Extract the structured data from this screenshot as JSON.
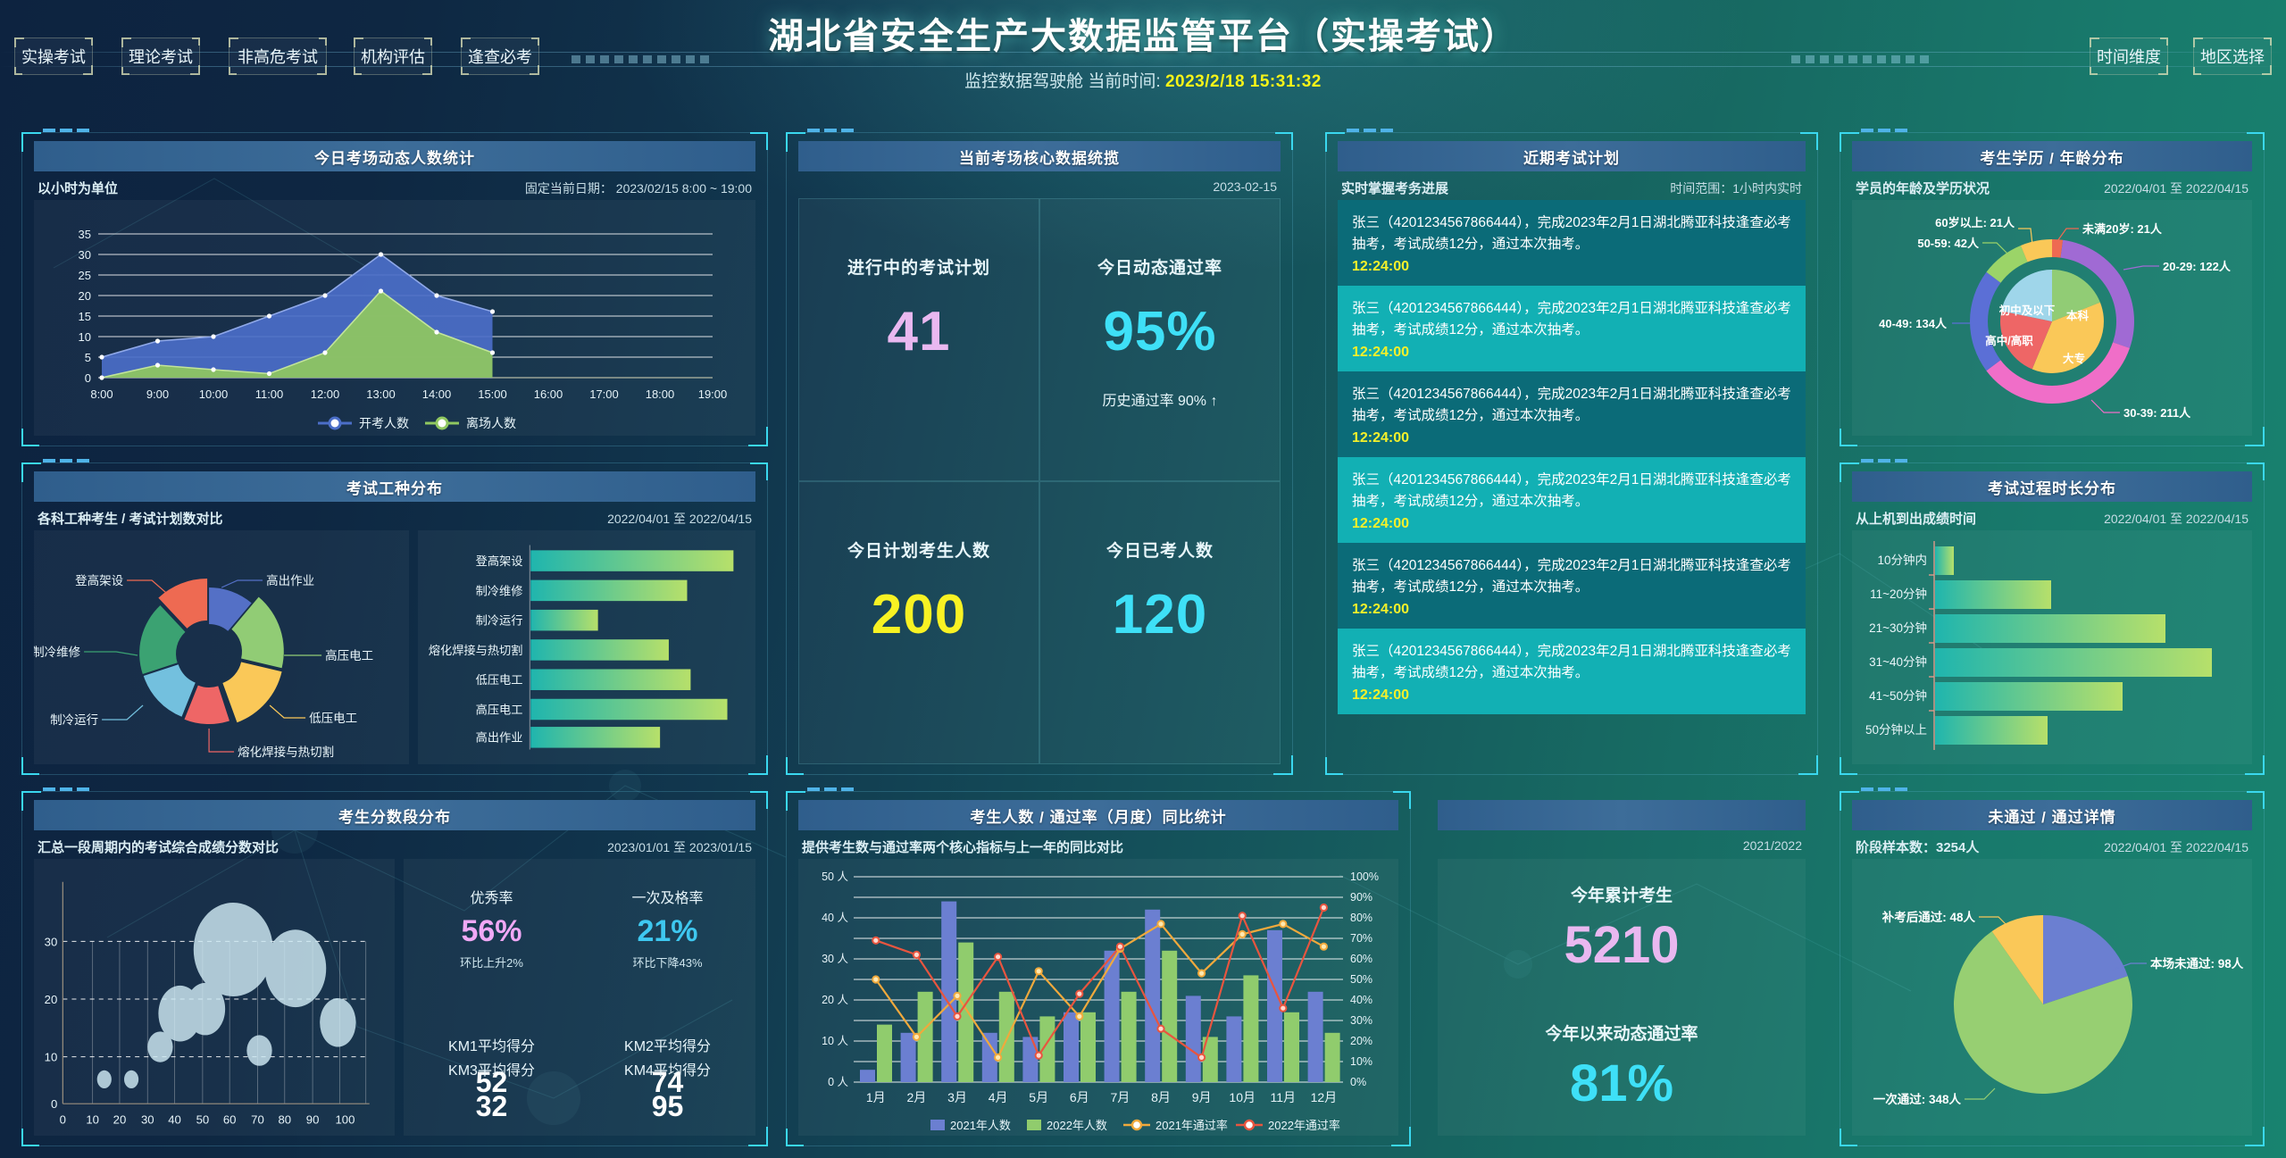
{
  "header": {
    "title": "湖北省安全生产大数据监管平台（实操考试）",
    "subtitle_prefix": "监控数据驾驶舱 当前时间:",
    "clock": "2023/2/18 15:31:32",
    "left_buttons": [
      "实操考试",
      "理论考试",
      "非高危考试",
      "机构评估",
      "逢查必考"
    ],
    "right_buttons": [
      "时间维度",
      "地区选择"
    ],
    "clock_color": "#f7f318"
  },
  "panels": {
    "attendance": {
      "title": "今日考场动态人数统计",
      "subtitle": "以小时为单位",
      "date": "固定当前日期： 2023/02/15 8:00 ~ 19:00"
    },
    "worktype": {
      "title": "考试工种分布",
      "subtitle": "各科工种考生 / 考试计划数对比",
      "date": "2022/04/01 至 2022/04/15"
    },
    "core": {
      "title": "当前考场核心数据统揽",
      "date": "2023-02-15",
      "cells": [
        {
          "label": "进行中的考试计划",
          "value": "41",
          "color": "#e9b8f0",
          "note": ""
        },
        {
          "label": "今日动态通过率",
          "value": "95%",
          "color": "#3ee0f7",
          "note": "历史通过率 90% ↑"
        },
        {
          "label": "今日计划考生人数",
          "value": "200",
          "color": "#f8f223",
          "note": ""
        },
        {
          "label": "今日已考人数",
          "value": "120",
          "color": "#3ee0f7",
          "note": ""
        }
      ]
    },
    "plans": {
      "title": "近期考试计划",
      "subtitle": "实时掌握考务进展",
      "date": "时间范围：1小时内实时",
      "items": [
        {
          "text": "张三（4201234567866444），完成2023年2月1日湖北腾亚科技逢查必考抽考，考试成绩12分，通过本次抽考。",
          "time": "12:24:00",
          "bg": "#0b6b78"
        },
        {
          "text": "张三（4201234567866444），完成2023年2月1日湖北腾亚科技逢查必考抽考，考试成绩12分，通过本次抽考。",
          "time": "12:24:00",
          "bg": "#12b0b4"
        },
        {
          "text": "张三（4201234567866444），完成2023年2月1日湖北腾亚科技逢查必考抽考，考试成绩12分，通过本次抽考。",
          "time": "12:24:00",
          "bg": "#0b6b78"
        },
        {
          "text": "张三（4201234567866444），完成2023年2月1日湖北腾亚科技逢查必考抽考，考试成绩12分，通过本次抽考。",
          "time": "12:24:00",
          "bg": "#12b0b4"
        },
        {
          "text": "张三（4201234567866444），完成2023年2月1日湖北腾亚科技逢查必考抽考，考试成绩12分，通过本次抽考。",
          "time": "12:24:00",
          "bg": "#0b6b78"
        },
        {
          "text": "张三（4201234567866444），完成2023年2月1日湖北腾亚科技逢查必考抽考，考试成绩12分，通过本次抽考。",
          "time": "12:24:00",
          "bg": "#12b0b4"
        }
      ]
    },
    "demographics": {
      "title": "考生学历 / 年龄分布",
      "subtitle": "学员的年龄及学历状况",
      "date": "2022/04/01 至 2022/04/15"
    },
    "duration": {
      "title": "考试过程时长分布",
      "subtitle": "从上机到出成绩时间",
      "date": "2022/04/01 至 2022/04/15"
    },
    "scores": {
      "title": "考生分数段分布",
      "subtitle": "汇总一段周期内的考试综合成绩分数对比",
      "date": "2023/01/01 至 2023/01/15",
      "stats": [
        {
          "label": "优秀率",
          "value": "56%",
          "color": "#f0a8f5",
          "note": "环比上升2%"
        },
        {
          "label": "一次及格率",
          "value": "21%",
          "color": "#3ec8f0",
          "note": "环比下降43%"
        },
        {
          "label": "KM1平均得分",
          "value": "52"
        },
        {
          "label": "KM2平均得分",
          "value": "74"
        },
        {
          "label": "KM3平均得分",
          "value": "32"
        },
        {
          "label": "KM4平均得分",
          "value": "95"
        }
      ]
    },
    "monthly": {
      "title": "考生人数 / 通过率（月度）同比统计",
      "subtitle": "提供考生数与通过率两个核心指标与上一年的同比对比",
      "date": "2021/2022",
      "year_stats": [
        {
          "label": "今年累计考生",
          "value": "5210",
          "color": "#e9b8f0"
        },
        {
          "label": "今年以来动态通过率",
          "value": "81%",
          "color": "#3ee0f7"
        }
      ]
    },
    "passdetail": {
      "title": "未通过 / 通过详情",
      "subtitle": "阶段样本数：3254人",
      "date": "2022/04/01 至 2022/04/15"
    }
  },
  "chart_data": [
    {
      "type": "area",
      "id": "attendance",
      "title": "今日考场动态人数统计",
      "xlabel": "",
      "ylabel": "",
      "categories": [
        "8:00",
        "9:00",
        "10:00",
        "11:00",
        "12:00",
        "13:00",
        "14:00",
        "15:00",
        "16:00",
        "17:00",
        "18:00",
        "19:00"
      ],
      "ylim": [
        0,
        37
      ],
      "yticks": [
        0,
        5,
        10,
        15,
        20,
        25,
        30,
        35
      ],
      "grid": true,
      "legend_position": "bottom",
      "series": [
        {
          "name": "开考人数",
          "color": "#4b6ec8",
          "values": [
            5,
            9,
            10,
            15,
            21,
            31,
            21,
            16,
            null,
            null,
            null,
            null
          ]
        },
        {
          "name": "离场人数",
          "color": "#90c860",
          "values": [
            0,
            3,
            2,
            1,
            6,
            21,
            11,
            6,
            null,
            null,
            null,
            null
          ]
        }
      ]
    },
    {
      "type": "pie",
      "id": "worktype-donut",
      "title": "各科工种考生",
      "labels": [
        "高出作业",
        "高压电工",
        "低压电工",
        "熔化焊接与热切割",
        "制冷运行",
        "制冷维修",
        "登高架设"
      ],
      "values": [
        13,
        16,
        14,
        11,
        8,
        17,
        21
      ],
      "colors": [
        "#5470c6",
        "#91cc75",
        "#fac858",
        "#ee6666",
        "#73c0de",
        "#3ba272",
        "#ee6a52"
      ]
    },
    {
      "type": "bar",
      "id": "worktype-bars",
      "title": "考试计划数",
      "orientation": "horizontal",
      "categories": [
        "登高架设",
        "制冷维修",
        "制冷运行",
        "熔化焊接与热切割",
        "低压电工",
        "高压电工",
        "高出作业"
      ],
      "values": [
        100,
        77,
        33,
        68,
        79,
        97,
        64
      ],
      "xlim": [
        0,
        105
      ]
    },
    {
      "type": "pie",
      "id": "education-inner",
      "title": "考生学历分布",
      "labels": [
        "本科",
        "大专",
        "高中/高职",
        "初中及以下"
      ],
      "values": [
        22,
        37,
        26,
        15
      ],
      "colors": [
        "#91cc75",
        "#fac858",
        "#ee6666",
        "#9fd6ea"
      ]
    },
    {
      "type": "pie",
      "id": "age-outer",
      "title": "考生年龄分布",
      "labels": [
        "未满20岁: 21人",
        "20-29: 122人",
        "30-39: 211人",
        "40-49: 134人",
        "50-59: 42人",
        "60岁以上: 21人"
      ],
      "short_labels": [
        "未满20岁",
        "20-29",
        "30-39",
        "40-49",
        "50-59",
        "60岁以上"
      ],
      "values": [
        21,
        122,
        211,
        134,
        42,
        21
      ],
      "colors": [
        "#ee6a52",
        "#a06ad4",
        "#f06ec8",
        "#5b6fd6",
        "#9bd468",
        "#fac858"
      ]
    },
    {
      "type": "bar",
      "id": "duration",
      "title": "考试过程时长分布",
      "orientation": "horizontal",
      "categories": [
        "10分钟内",
        "11~20分钟",
        "21~30分钟",
        "31~40分钟",
        "41~50分钟",
        "50分钟以上"
      ],
      "values": [
        6,
        41,
        81,
        96,
        66,
        39
      ],
      "xlim": [
        0,
        100
      ]
    },
    {
      "type": "scatter",
      "id": "scores-bubble",
      "title": "考生分数段分布",
      "xlabel": "",
      "ylabel": "",
      "xlim": [
        0,
        100
      ],
      "ylim": [
        0,
        32
      ],
      "xticks": [
        0,
        10,
        20,
        30,
        40,
        50,
        60,
        70,
        80,
        90,
        100
      ],
      "yticks": [
        0,
        10,
        20,
        30
      ],
      "grid": true,
      "points": [
        {
          "x": 15,
          "y": 4,
          "r": 7
        },
        {
          "x": 25,
          "y": 4,
          "r": 7
        },
        {
          "x": 35,
          "y": 12,
          "r": 13
        },
        {
          "x": 75,
          "y": 11,
          "r": 13
        },
        {
          "x": 42,
          "y": 17,
          "r": 22
        },
        {
          "x": 50,
          "y": 18,
          "r": 21
        },
        {
          "x": 93,
          "y": 15,
          "r": 19
        },
        {
          "x": 63,
          "y": 27,
          "r": 42
        },
        {
          "x": 82,
          "y": 23,
          "r": 33
        }
      ]
    },
    {
      "type": "bar",
      "id": "monthly",
      "title": "考生人数 / 通过率（月度）同比统计",
      "categories": [
        "1月",
        "2月",
        "3月",
        "4月",
        "5月",
        "6月",
        "7月",
        "8月",
        "9月",
        "10月",
        "11月",
        "12月"
      ],
      "ylabel_left": "人",
      "ylabel_right": "%",
      "ylim_left": [
        0,
        50
      ],
      "ylim_right": [
        0,
        100
      ],
      "yticks_left": [
        0,
        10,
        20,
        30,
        40,
        50
      ],
      "yticks_right": [
        0,
        10,
        20,
        30,
        40,
        50,
        60,
        70,
        80,
        90,
        100
      ],
      "series": [
        {
          "name": "2021年人数",
          "type": "bar",
          "color": "#6b7fd1",
          "values": [
            3,
            12,
            44,
            12,
            11,
            17,
            32,
            42,
            21,
            16,
            37,
            22
          ]
        },
        {
          "name": "2022年人数",
          "type": "bar",
          "color": "#90cc6d",
          "values": [
            14,
            22,
            34,
            22,
            16,
            17,
            22,
            32,
            11,
            26,
            17,
            12
          ]
        },
        {
          "name": "2021年通过率",
          "type": "line",
          "color": "#f0a93c",
          "values": [
            50,
            22,
            42,
            12,
            54,
            32,
            65,
            77,
            53,
            72,
            77,
            66
          ]
        },
        {
          "name": "2022年通过率",
          "type": "line",
          "color": "#e8553f",
          "values": [
            69,
            62,
            32,
            61,
            13,
            43,
            66,
            26,
            12,
            81,
            36,
            85
          ]
        }
      ]
    },
    {
      "type": "pie",
      "id": "passdetail",
      "title": "未通过 / 通过详情",
      "labels": [
        "本场未通过: 98人",
        "一次通过: 348人",
        "补考后通过: 48人"
      ],
      "values": [
        98,
        348,
        48
      ],
      "colors": [
        "#6b7fd1",
        "#97cf72",
        "#fac858"
      ]
    }
  ]
}
